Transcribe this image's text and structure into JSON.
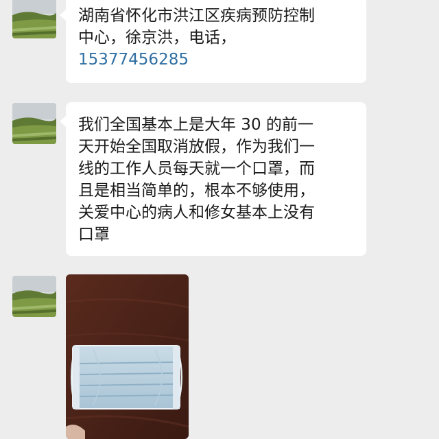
{
  "messages": [
    {
      "lines": [
        "湖南省怀化市洪江区疾病预防控制",
        "中心，徐京洪，电话，"
      ],
      "phone": "15377456285"
    },
    {
      "lines": [
        "我们全国基本上是大年 30 的前一",
        "天开始全国取消放假，作为我们一",
        "线的工作人员每天就一个口罩，而",
        "且是相当简单的，根本不够使用，",
        "关爱中心的病人和修女基本上没有",
        "口罩"
      ]
    }
  ],
  "colors": {
    "background": "#ededed",
    "bubble": "#ffffff",
    "text": "#1b1b1b",
    "link": "#2f6fa3"
  },
  "icons": {
    "avatar": "landscape-avatar-icon",
    "photo": "face-mask-photo"
  }
}
